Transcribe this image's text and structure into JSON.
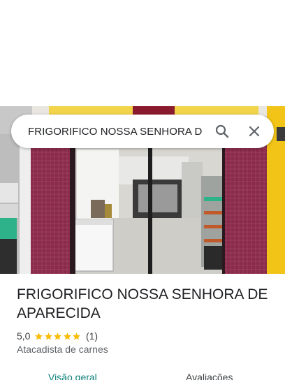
{
  "search": {
    "query": "FRIGORIFICO NOSSA SENHORA DE APARECIDA"
  },
  "place": {
    "name": "FRIGORIFICO NOSSA SENHORA DE APARECIDA",
    "rating": "5,0",
    "review_count": "(1)",
    "stars": 5,
    "category": "Atacadista de carnes"
  },
  "tabs": [
    {
      "label": "Visão geral",
      "active": true
    },
    {
      "label": "Avaliações",
      "active": false
    }
  ],
  "colors": {
    "accent": "#0b7f7a",
    "star": "#fbbc04",
    "wall": "#8b2a4a",
    "pillar_yellow": "#f2c418"
  },
  "icons": {
    "search": "search-icon",
    "close": "close-icon",
    "star": "star-icon"
  }
}
